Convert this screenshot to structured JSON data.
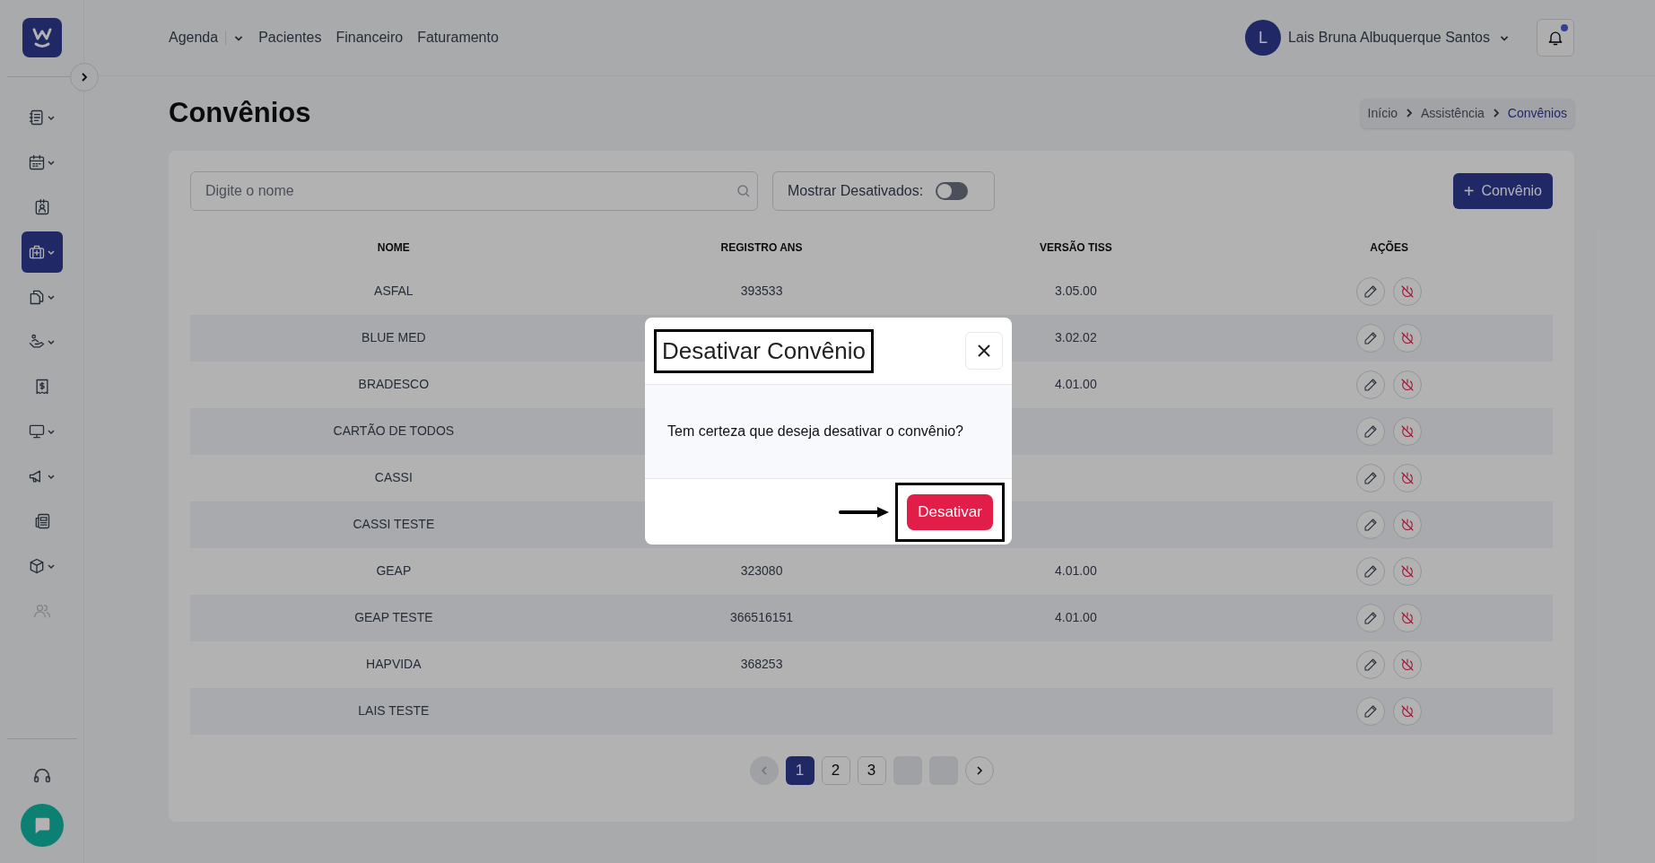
{
  "sidebar": {
    "items": [
      {
        "selected": false,
        "submenu": true,
        "disabled": false
      },
      {
        "selected": false,
        "submenu": true,
        "disabled": false
      },
      {
        "selected": false,
        "submenu": false,
        "disabled": false
      },
      {
        "selected": true,
        "submenu": true,
        "disabled": false
      },
      {
        "selected": false,
        "submenu": true,
        "disabled": false
      },
      {
        "selected": false,
        "submenu": true,
        "disabled": false
      },
      {
        "selected": false,
        "submenu": false,
        "disabled": false
      },
      {
        "selected": false,
        "submenu": true,
        "disabled": false
      },
      {
        "selected": false,
        "submenu": true,
        "disabled": false
      },
      {
        "selected": false,
        "submenu": false,
        "disabled": false
      },
      {
        "selected": false,
        "submenu": true,
        "disabled": false
      },
      {
        "selected": false,
        "submenu": false,
        "disabled": true
      }
    ]
  },
  "top_nav": {
    "items": [
      {
        "label": "Agenda",
        "submenu": true
      },
      {
        "label": "Pacientes",
        "submenu": false
      },
      {
        "label": "Financeiro",
        "submenu": false
      },
      {
        "label": "Faturamento",
        "submenu": false
      }
    ],
    "user": {
      "initial": "L",
      "name": "Lais Bruna Albuquerque Santos"
    },
    "notifications": {
      "unread": true
    }
  },
  "page_title": "Convênios",
  "breadcrumb": [
    {
      "label": "Início",
      "selected": false
    },
    {
      "label": "Assistência",
      "selected": false
    },
    {
      "label": "Convênios",
      "selected": true
    }
  ],
  "search": {
    "placeholder": "Digite o nome"
  },
  "show_disabled": {
    "label": "Mostrar Desativados:",
    "on": false
  },
  "add_button": {
    "icon": "+",
    "label": "Convênio"
  },
  "table": {
    "columns": [
      "NOME",
      "REGISTRO ANS",
      "VERSÃO TISS",
      "AÇÕES"
    ],
    "rows": [
      {
        "name": "ASFAL",
        "registro": "393533",
        "versao": "3.05.00"
      },
      {
        "name": "BLUE MED",
        "versao": "3.02.02"
      },
      {
        "name": "BRADESCO",
        "versao": "4.01.00"
      },
      {
        "name": "CARTÃO DE TODOS"
      },
      {
        "name": "CASSI"
      },
      {
        "name": "CASSI TESTE"
      },
      {
        "name": "GEAP",
        "registro": "323080",
        "versao": "4.01.00"
      },
      {
        "name": "GEAP TESTE",
        "registro": "366516151",
        "versao": "4.01.00"
      },
      {
        "name": "HAPVIDA",
        "registro": "368253"
      },
      {
        "name": "LAIS TESTE"
      }
    ]
  },
  "pagination": {
    "previous_disabled": true,
    "pages": [
      {
        "kind": "page",
        "label": "1",
        "selected": true
      },
      {
        "kind": "page",
        "label": "2",
        "selected": false
      },
      {
        "kind": "page",
        "label": "3",
        "selected": false
      },
      {
        "kind": "blank",
        "selected": false
      },
      {
        "kind": "blank",
        "selected": false
      }
    ]
  },
  "modal": {
    "title": "Desativar Convênio",
    "title_highlighted": true,
    "message": "Tem certeza que deseja desativar o convênio?",
    "confirm_button": {
      "label": "Desativar",
      "highlighted": true,
      "arrow": true
    }
  }
}
